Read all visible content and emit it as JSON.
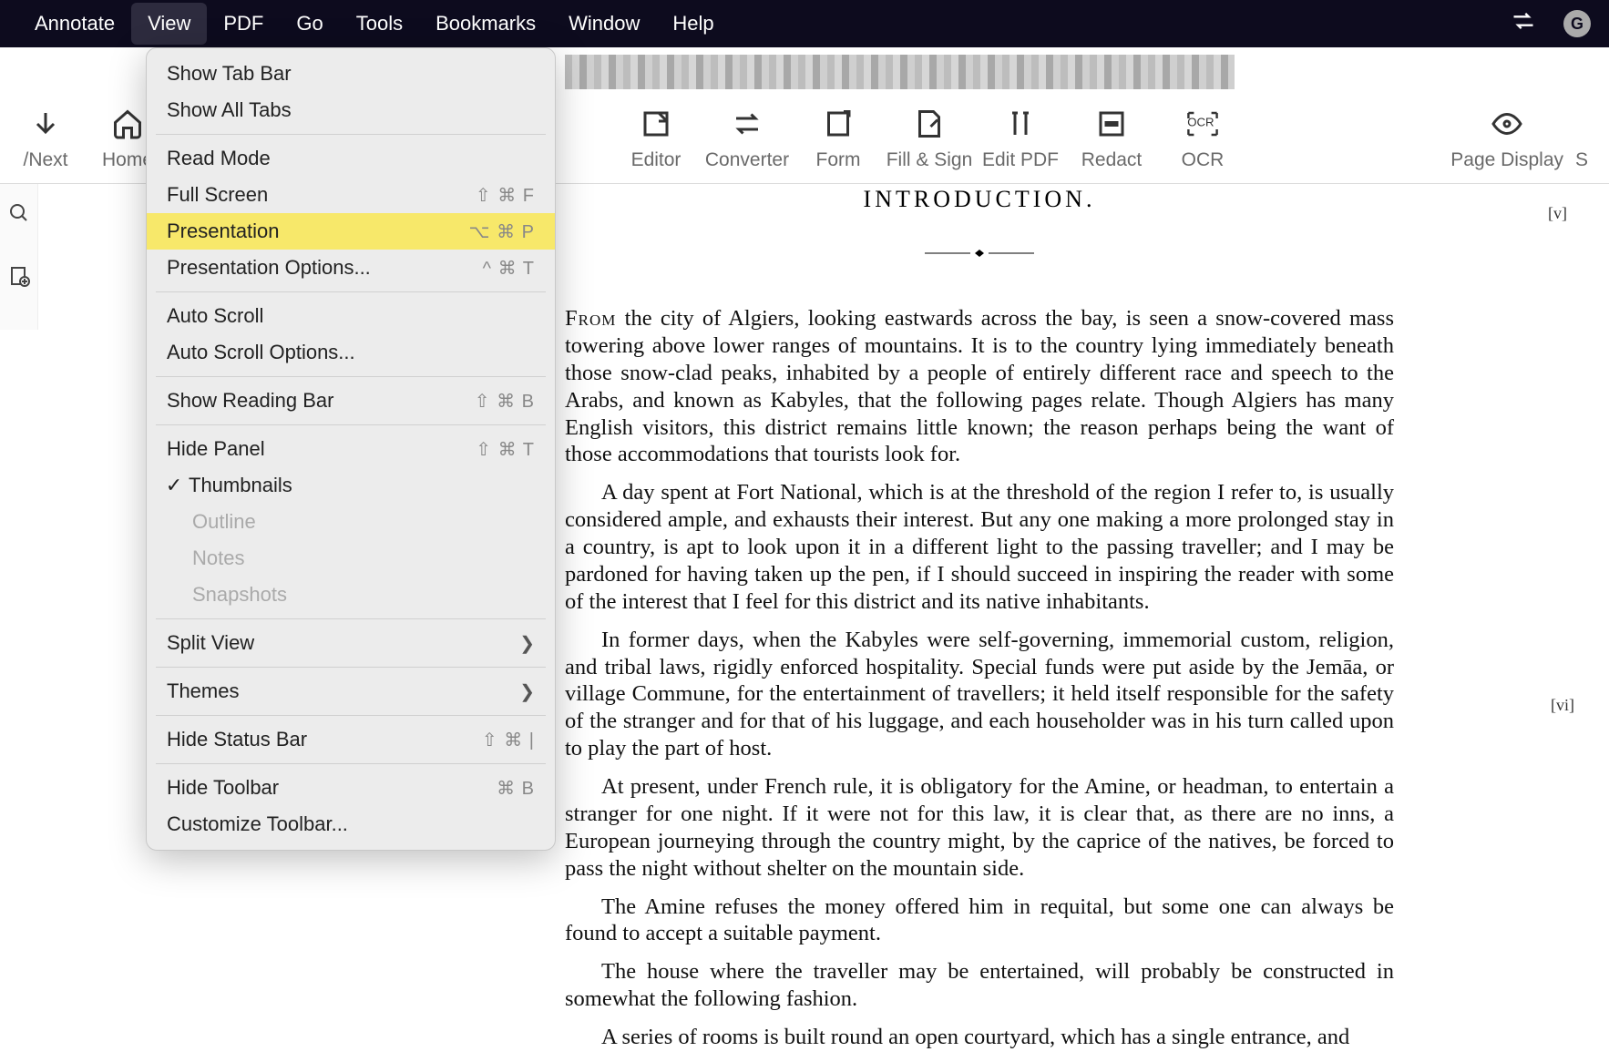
{
  "menubar": {
    "items": [
      "Annotate",
      "View",
      "PDF",
      "Go",
      "Tools",
      "Bookmarks",
      "Window",
      "Help"
    ],
    "active_index": 1
  },
  "toolbar": {
    "left_partial": {
      "label": "/Next"
    },
    "home": {
      "label": "Home"
    },
    "editor": {
      "label": "Editor"
    },
    "converter": {
      "label": "Converter"
    },
    "form": {
      "label": "Form"
    },
    "fillsign": {
      "label": "Fill & Sign"
    },
    "editpdf": {
      "label": "Edit PDF"
    },
    "redact": {
      "label": "Redact"
    },
    "ocr": {
      "label": "OCR"
    },
    "pagedisplay": {
      "label": "Page Display"
    },
    "right_partial": {
      "label": "S"
    }
  },
  "dropdown": {
    "show_tab_bar": {
      "label": "Show Tab Bar"
    },
    "show_all_tabs": {
      "label": "Show All Tabs"
    },
    "read_mode": {
      "label": "Read Mode"
    },
    "full_screen": {
      "label": "Full Screen",
      "shortcut": "⇧ ⌘ F"
    },
    "presentation": {
      "label": "Presentation",
      "shortcut": "⌥ ⌘ P"
    },
    "presentation_options": {
      "label": "Presentation Options...",
      "shortcut": "^ ⌘ T"
    },
    "auto_scroll": {
      "label": "Auto Scroll"
    },
    "auto_scroll_options": {
      "label": "Auto Scroll Options..."
    },
    "show_reading_bar": {
      "label": "Show Reading Bar",
      "shortcut": "⇧ ⌘ B"
    },
    "hide_panel": {
      "label": "Hide Panel",
      "shortcut": "⇧ ⌘ T"
    },
    "thumbnails": {
      "label": "Thumbnails"
    },
    "outline": {
      "label": "Outline"
    },
    "notes": {
      "label": "Notes"
    },
    "snapshots": {
      "label": "Snapshots"
    },
    "split_view": {
      "label": "Split View"
    },
    "themes": {
      "label": "Themes"
    },
    "hide_status_bar": {
      "label": "Hide Status Bar",
      "shortcut": "⇧ ⌘ |"
    },
    "hide_toolbar": {
      "label": "Hide Toolbar",
      "shortcut": "⌘ B"
    },
    "customize_toolbar": {
      "label": "Customize Toolbar..."
    }
  },
  "document": {
    "title": "INTRODUCTION.",
    "page_mark_1": "[v]",
    "page_mark_2": "[vi]",
    "p1_lead": "From",
    "p1": " the city of Algiers, looking eastwards across the bay, is seen a snow-covered mass towering above lower ranges of mountains. It is to the country lying immediately beneath those snow-clad peaks, inhabited by a people of entirely different race and speech to the Arabs, and known as Kabyles, that the following pages relate. Though Algiers has many English visitors, this district remains little known; the reason perhaps being the want of those accommodations that tourists look for.",
    "p2": "A day spent at Fort National, which is at the threshold of the region I refer to, is usually considered ample, and exhausts their interest. But any one making a more prolonged stay in a country, is apt to look upon it in a different light to the passing traveller; and I may be pardoned for having taken up the pen, if I should succeed in inspiring the reader with some of the interest that I feel for this district and its native inhabitants.",
    "p3": "In former days, when the Kabyles were self-governing, immemorial custom, religion, and tribal laws, rigidly enforced hospitality. Special funds were put aside by the Jemāa, or village Commune, for the entertainment of travellers; it held itself responsible for the safety of the stranger and for that of his luggage, and each householder was in his turn called upon to play the part of host.",
    "p4": "At present, under French rule, it is obligatory for the Amine, or headman, to entertain a stranger for one night. If it were not for this law, it is clear that, as there are no inns, a European journeying through the country might, by the caprice of the natives, be forced to pass the night without shelter on the mountain side.",
    "p5": "The Amine refuses the money offered him in requital, but some one can always be found to accept a suitable payment.",
    "p6": "The house where the traveller may be entertained, will probably be constructed in somewhat the following fashion.",
    "p7": "A series of rooms is built round an open courtyard, which has a single entrance, and"
  }
}
